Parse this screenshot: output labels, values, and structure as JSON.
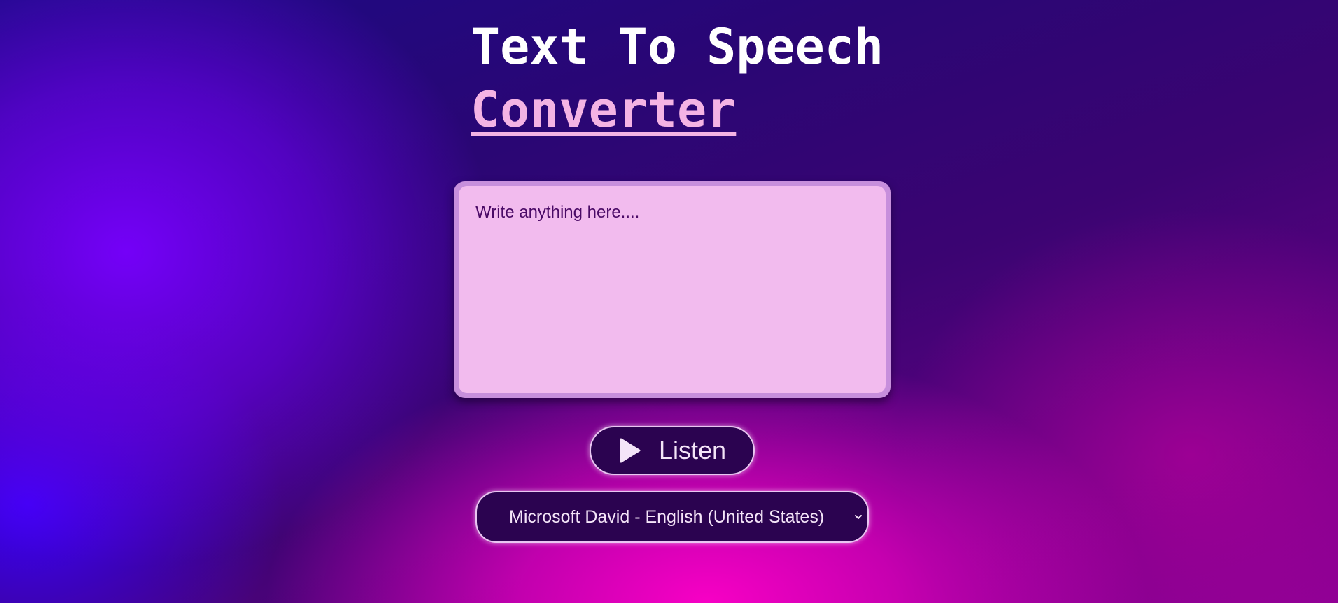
{
  "header": {
    "title_line1": "Text To Speech",
    "title_line2": "Converter"
  },
  "editor": {
    "placeholder": "Write anything here....",
    "value": ""
  },
  "listen_button": {
    "label": "Listen",
    "icon": "play-icon"
  },
  "voice_select": {
    "selected": "Microsoft David - English (United States)",
    "icon": "chevron-down-icon"
  },
  "colors": {
    "title": "#ffffff",
    "accent_title": "#f4b3e4",
    "textarea_bg": "#f2bbee",
    "button_bg": "#2b0350"
  }
}
